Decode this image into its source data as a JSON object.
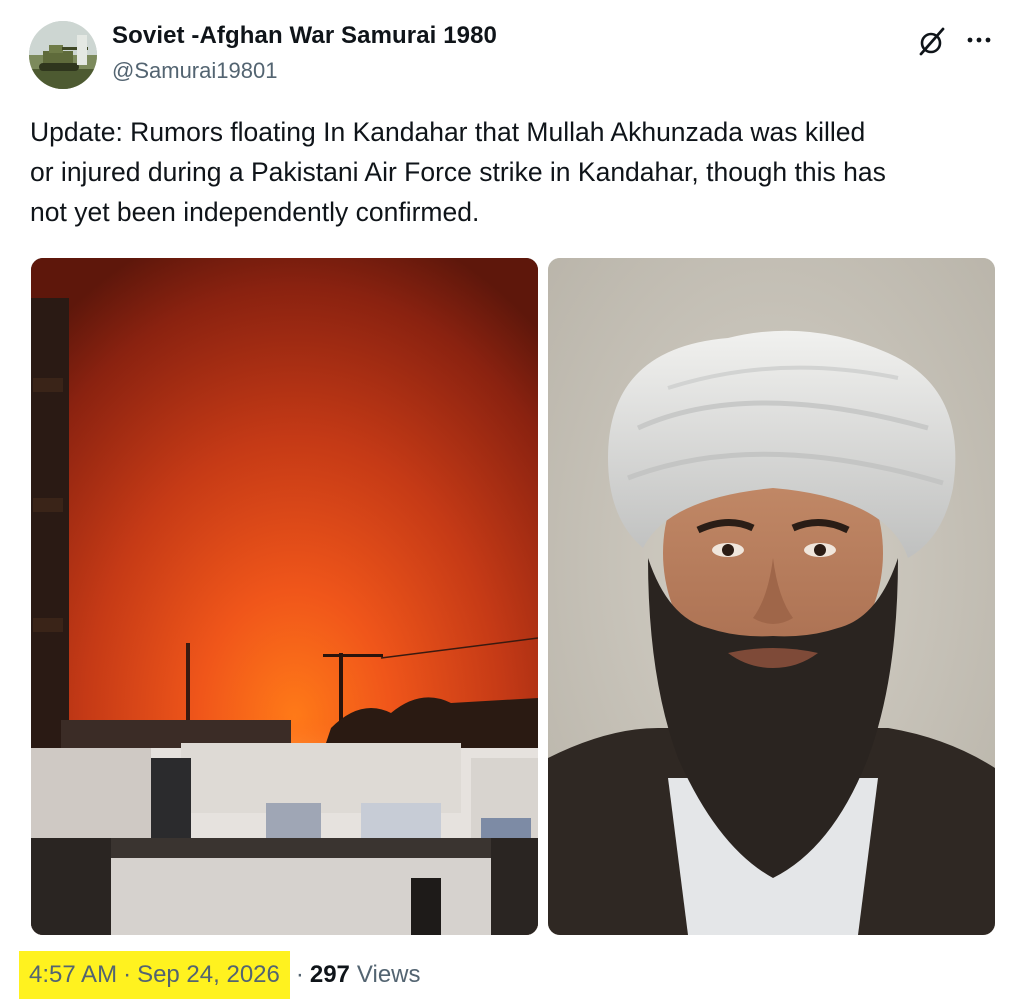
{
  "author": {
    "display_name": "Soviet -Afghan War Samurai 1980",
    "handle": "@Samurai19801",
    "avatar_icon": "avatar-image"
  },
  "actions": {
    "grok_icon": "grok-icon",
    "more_icon": "more-options-icon"
  },
  "tweet": {
    "text_lines": [
      "Update: Rumors floating In Kandahar that Mullah Akhunzada was killed",
      "or injured during a Pakistani Air Force strike in Kandahar, though this has",
      "not yet been independently confirmed."
    ]
  },
  "media": [
    {
      "icon": "night-fire-photo"
    },
    {
      "icon": "portrait-painting"
    }
  ],
  "meta": {
    "time": "4:57 AM",
    "separator": "·",
    "date": "Sep 24, 2026",
    "views_count": "297",
    "views_label": "Views",
    "highlight_color": "#fff21f"
  },
  "colors": {
    "text_primary": "#0f1419",
    "text_secondary": "#536471"
  }
}
